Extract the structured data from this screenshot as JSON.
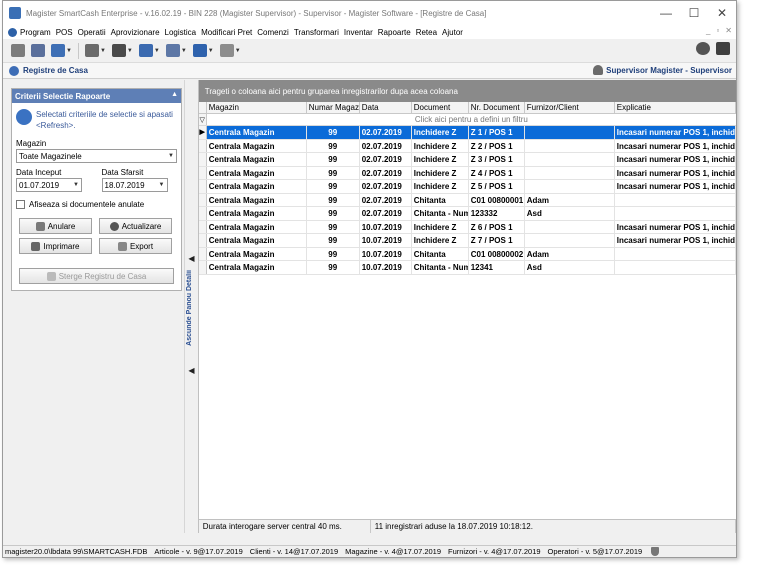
{
  "window": {
    "title": "Magister SmartCash Enterprise - v.16.02.19 - BIN 228 (Magister Supervisor) - Supervisor - Magister Software - [Registre de Casa]",
    "controls": [
      "—",
      "☐",
      "✕"
    ]
  },
  "menu": {
    "items": [
      "Program",
      "POS",
      "Operatii",
      "Aprovizionare",
      "Logistica",
      "Modificari Pret",
      "Comenzi",
      "Transformari",
      "Inventar",
      "Rapoarte",
      "Retea",
      "Ajutor"
    ],
    "mdi_controls": [
      "_",
      "▫",
      "✕"
    ]
  },
  "toolbar": {
    "icons": [
      "print-icon",
      "cash-register-icon",
      "user-icon",
      "settings-icon",
      "pos-icon",
      "transfer-icon",
      "document-icon",
      "network-icon",
      "export-icon"
    ],
    "colors": [
      "#7c7c7c",
      "#5a6f9b",
      "#3e6fb5",
      "#6b6b6b",
      "#4a4a4a",
      "#3b6ab0",
      "#5d77a6",
      "#2e62ad",
      "#8d8d8d"
    ]
  },
  "document": {
    "title": "Registre de Casa",
    "user": "Supervisor Magister - Supervisor"
  },
  "filter": {
    "header": "Criterii Selectie Rapoarte",
    "hint": "Selectati criteriile de selectie si apasati <Refresh>.",
    "magazin_label": "Magazin",
    "magazin_value": "Toate Magazinele",
    "date_start_label": "Data Inceput",
    "date_start_value": "01.07.2019",
    "date_end_label": "Data Sfarsit",
    "date_end_value": "18.07.2019",
    "checkbox_label": "Afiseaza si documentele anulate",
    "btn_cancel": "Anulare",
    "btn_refresh": "Actualizare",
    "btn_print": "Imprimare",
    "btn_export": "Export",
    "btn_delete": "Sterge Registru de Casa"
  },
  "splitter": {
    "label": "Ascunde Panou Detalii"
  },
  "grid": {
    "group_hint": "Trageti o coloana aici pentru gruparea inregistrarilor dupa acea coloana",
    "filter_hint": "Click aici pentru a defini un filtru",
    "columns": [
      "Magazin",
      "Numar Magazin",
      "Data",
      "Document",
      "Nr. Document",
      "Furnizor/Client",
      "Explicatie"
    ],
    "rows": [
      [
        "Centrala Magazin",
        "99",
        "02.07.2019",
        "Inchidere Z",
        "Z 1 / POS 1",
        "",
        "Incasari numerar POS 1, inchid"
      ],
      [
        "Centrala Magazin",
        "99",
        "02.07.2019",
        "Inchidere Z",
        "Z 2 / POS 1",
        "",
        "Incasari numerar POS 1, inchid"
      ],
      [
        "Centrala Magazin",
        "99",
        "02.07.2019",
        "Inchidere Z",
        "Z 3 / POS 1",
        "",
        "Incasari numerar POS 1, inchid"
      ],
      [
        "Centrala Magazin",
        "99",
        "02.07.2019",
        "Inchidere Z",
        "Z 4 / POS 1",
        "",
        "Incasari numerar POS 1, inchid"
      ],
      [
        "Centrala Magazin",
        "99",
        "02.07.2019",
        "Inchidere Z",
        "Z 5 / POS 1",
        "",
        "Incasari numerar POS 1, inchid"
      ],
      [
        "Centrala Magazin",
        "99",
        "02.07.2019",
        "Chitanta",
        "C01 00800001",
        "Adam",
        ""
      ],
      [
        "Centrala Magazin",
        "99",
        "02.07.2019",
        "Chitanta - Num",
        "123332",
        "Asd",
        ""
      ],
      [
        "Centrala Magazin",
        "99",
        "10.07.2019",
        "Inchidere Z",
        "Z 6 / POS 1",
        "",
        "Incasari numerar POS 1, inchid"
      ],
      [
        "Centrala Magazin",
        "99",
        "10.07.2019",
        "Inchidere Z",
        "Z 7 / POS 1",
        "",
        "Incasari numerar POS 1, inchid"
      ],
      [
        "Centrala Magazin",
        "99",
        "10.07.2019",
        "Chitanta",
        "C01 00800002",
        "Adam",
        ""
      ],
      [
        "Centrala Magazin",
        "99",
        "10.07.2019",
        "Chitanta - Num",
        "12341",
        "Asd",
        ""
      ]
    ],
    "selected_row": 0
  },
  "inner_status": {
    "duration": "Durata interogare server central 40 ms.",
    "records": "11 inregistrari aduse la 18.07.2019 10:18:12."
  },
  "status": {
    "items": [
      "magister20.0\\lbdata 99\\SMARTCASH.FDB",
      "Articole - v. 9@17.07.2019",
      "Clienti - v. 14@17.07.2019",
      "Magazine - v. 4@17.07.2019",
      "Furnizori - v. 4@17.07.2019",
      "Operatori - v. 5@17.07.2019"
    ]
  }
}
